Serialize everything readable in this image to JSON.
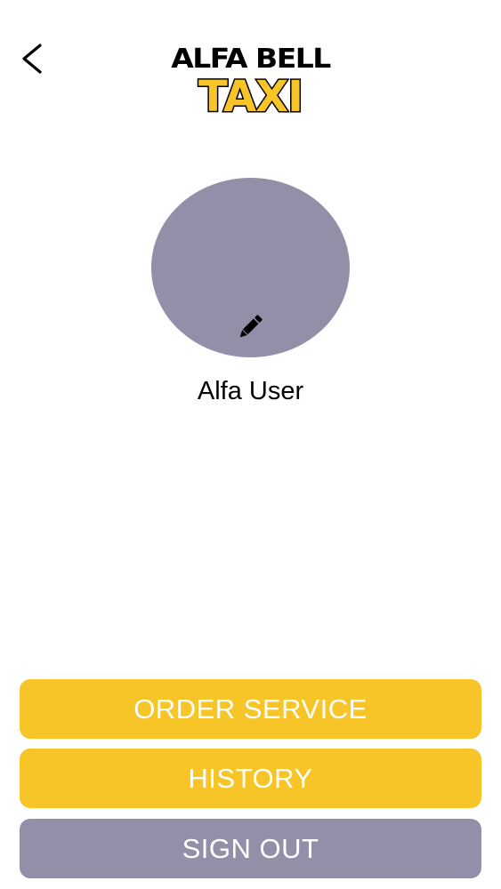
{
  "header": {
    "back_icon": "chevron-left-icon",
    "logo_line1": "ALFA BELL",
    "logo_line2": "TAXI"
  },
  "profile": {
    "name": "Alfa User",
    "edit_icon": "pencil-icon"
  },
  "actions": {
    "order_service": "ORDER SERVICE",
    "history": "HISTORY",
    "sign_out": "SIGN OUT"
  },
  "colors": {
    "accent_yellow": "#f7c527",
    "neutral_gray": "#9190a8",
    "text_black": "#000000"
  }
}
